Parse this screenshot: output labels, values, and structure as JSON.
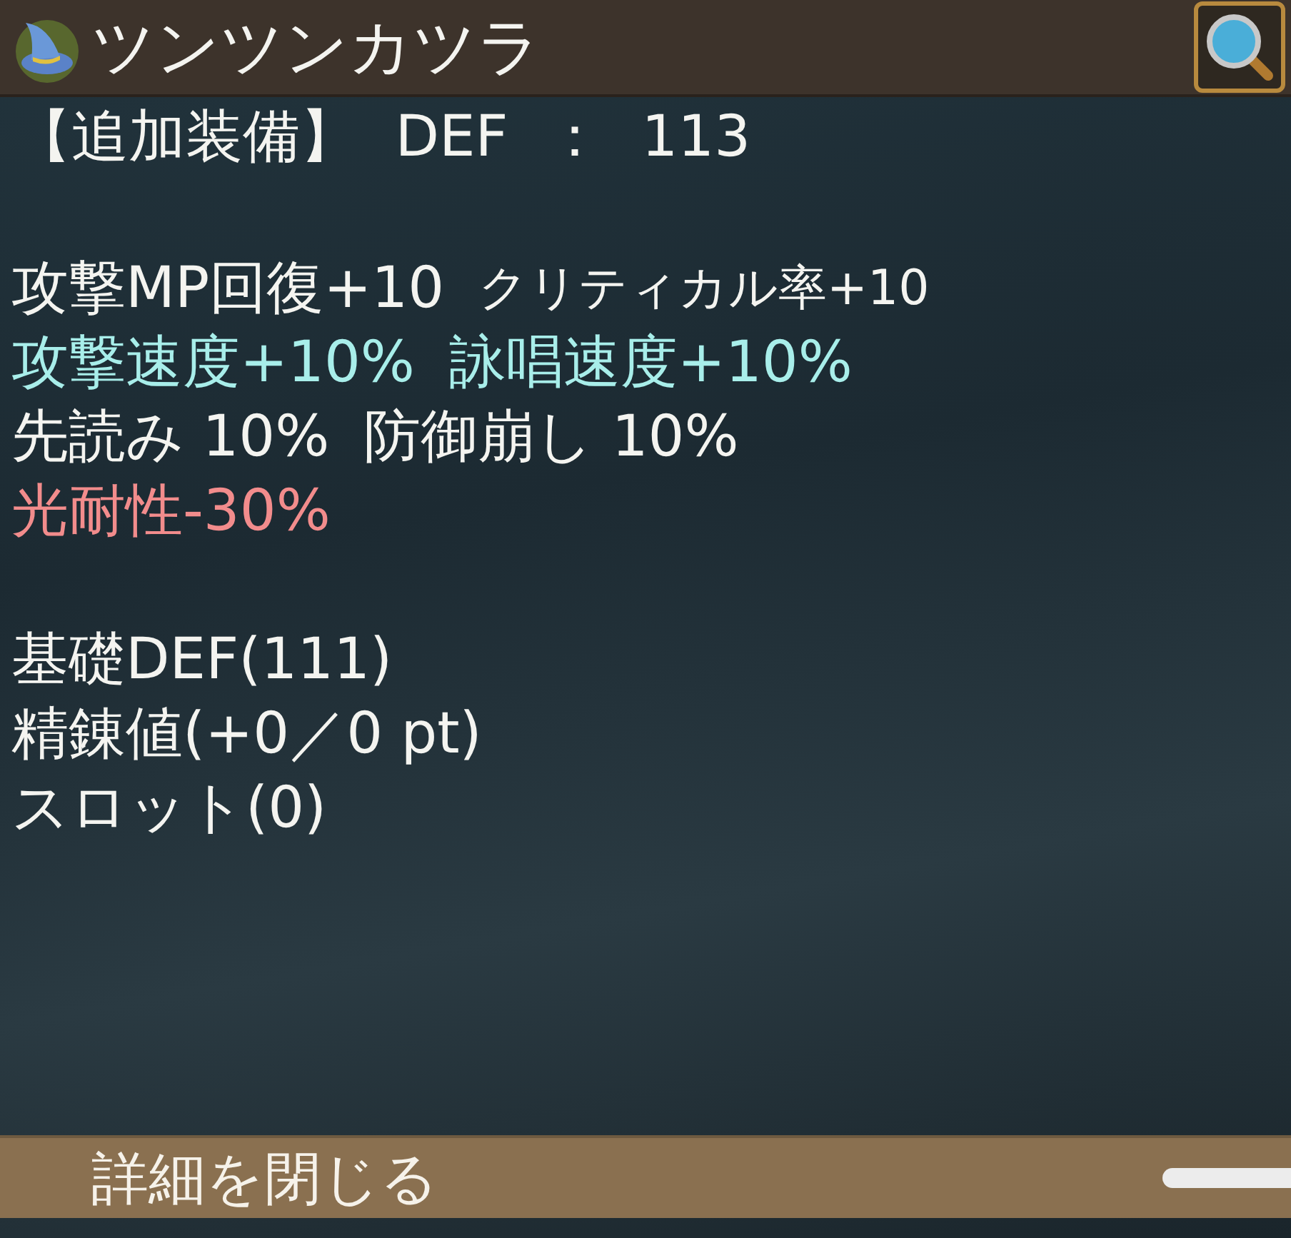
{
  "header": {
    "title": "ツンツンカツラ"
  },
  "summary": "【追加装備】 DEF ： 113",
  "stat_sections": [
    {
      "lines": [
        {
          "color": "#f4f4f0",
          "texts": [
            "攻撃MP回復+10",
            "クリティカル率+10"
          ]
        },
        {
          "color": "#a8eeea",
          "texts": [
            "攻撃速度+10%",
            "詠唱速度+10%"
          ]
        },
        {
          "color": "#f4f4f0",
          "texts": [
            "先読み 10%",
            "防御崩し 10%"
          ]
        },
        {
          "color": "#f28c8c",
          "texts": [
            "光耐性-30%"
          ]
        }
      ]
    },
    {
      "lines": [
        {
          "color": "#f4f4f0",
          "texts": [
            "基礎DEF(111)"
          ]
        },
        {
          "color": "#f4f4f0",
          "texts": [
            "精錬値(+0／0 pt)"
          ]
        },
        {
          "color": "#f4f4f0",
          "texts": [
            "スロット(0)"
          ]
        }
      ]
    }
  ],
  "footer": {
    "button": "詳細を閉じる"
  }
}
